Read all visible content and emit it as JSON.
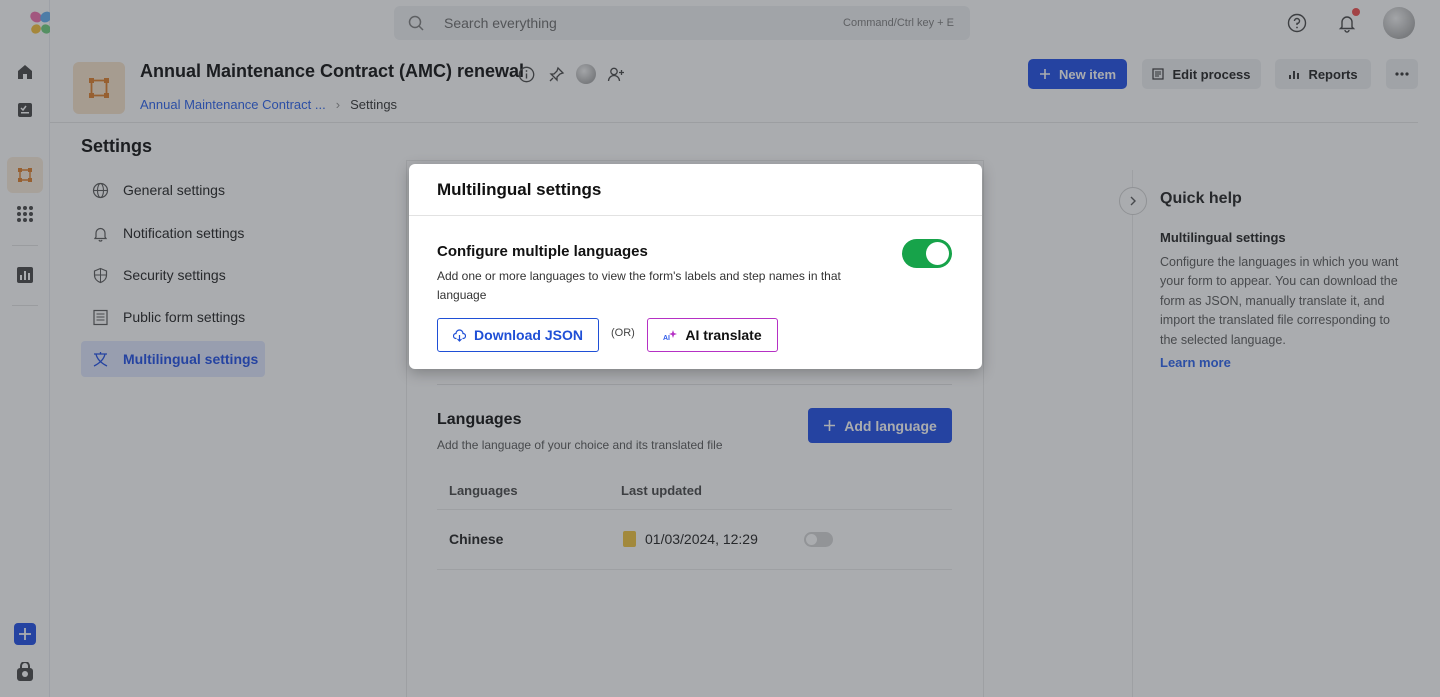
{
  "topbar": {
    "search_placeholder": "Search everything",
    "search_hint": "Command/Ctrl key + E",
    "icons": [
      "help-icon",
      "bell-icon",
      "avatar"
    ]
  },
  "header": {
    "title": "Annual Maintenance Contract (AMC) renewal",
    "breadcrumb": [
      "Annual Maintenance Contract ...",
      "Settings"
    ],
    "buttons": {
      "new_item": "New item",
      "edit_process": "Edit process",
      "reports": "Reports"
    }
  },
  "settings": {
    "heading": "Settings",
    "items": [
      {
        "label": "General settings",
        "icon": "globe-icon"
      },
      {
        "label": "Notification settings",
        "icon": "bell-icon"
      },
      {
        "label": "Security settings",
        "icon": "shield-icon"
      },
      {
        "label": "Public form settings",
        "icon": "form-icon"
      },
      {
        "label": "Multilingual settings",
        "icon": "translate-icon",
        "active": true
      }
    ]
  },
  "languages": {
    "heading": "Languages",
    "subtitle": "Add the language of your choice and its translated file",
    "add_button": "Add language",
    "columns": [
      "Languages",
      "Last updated"
    ],
    "rows": [
      {
        "language": "Chinese",
        "last_updated": "01/03/2024, 12:29",
        "enabled": false
      }
    ]
  },
  "quick_help": {
    "title": "Quick help",
    "subtitle": "Multilingual settings",
    "body": "Configure the languages in which you want your form to appear. You can download the form as JSON, manually translate it, and import the translated file corresponding to the selected language.",
    "link": "Learn more"
  },
  "modal": {
    "title": "Multilingual settings",
    "heading": "Configure multiple languages",
    "description": "Add one or more languages to view the form's labels and step names in that language",
    "toggle_on": true,
    "download_button": "Download JSON",
    "or_text": "(OR)",
    "ai_button": "AI translate"
  },
  "colors": {
    "primary": "#2f5bea",
    "toggle_on": "#17a34a",
    "ai_border": "#b530c4"
  }
}
